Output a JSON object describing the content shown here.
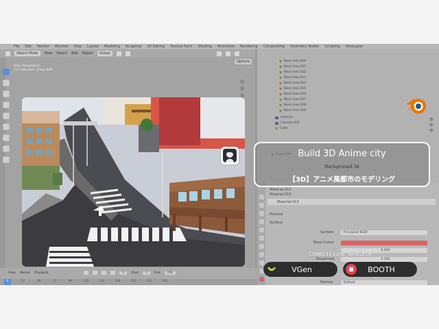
{
  "menubar": {
    "items": [
      "File",
      "Edit",
      "Render",
      "Window",
      "Help",
      "Layout",
      "Modeling",
      "Sculpting",
      "UV Editing",
      "Texture Paint",
      "Shading",
      "Animation",
      "Rendering",
      "Compositing",
      "Geometry Nodes",
      "Scripting",
      "ViewLayer"
    ]
  },
  "viewport": {
    "mode": "Object Mode",
    "menu": [
      "View",
      "Select",
      "Add",
      "Object"
    ],
    "orientation": "Global",
    "options_label": "Options",
    "info_line1": "User Perspective",
    "info_line2": "(1) Collection | Cube.039"
  },
  "outliner": {
    "items": [
      "Neon tree.010",
      "Neon tree.011",
      "Neon tree.012",
      "Neon tree.013",
      "Neon tree.014",
      "Neon tree.015",
      "Neon tree.016",
      "Neon tree.017",
      "Neon tree.018",
      "Neon tree.019",
      "Camera",
      "Camera.001",
      "Cube",
      "Cube.039"
    ]
  },
  "properties": {
    "material_slots": [
      "Material.012",
      "Material.013"
    ],
    "material_name": "Material.013",
    "preview_label": "Preview",
    "surface_label": "Surface",
    "surface_field_label": "Surface",
    "surface_value": "Principled BSDF",
    "base_color_label": "Base Colour",
    "roughness_label": "Roughness",
    "roughness_value": "0.500",
    "metallic_value": "0.000",
    "normal_label": "Normal",
    "normal_value": "Default"
  },
  "timeline": {
    "menu": [
      "View",
      "Marker",
      "Playback"
    ],
    "current_frame": "1",
    "start_label": "Start",
    "start_value": "1",
    "end_label": "End",
    "end_value": "250",
    "ruler": [
      "0",
      "24",
      "48",
      "72",
      "96",
      "120",
      "144",
      "168",
      "192",
      "216",
      "240"
    ]
  },
  "overlay": {
    "title": "Build 3D Anime city",
    "subtitle": "Background 3d",
    "japanese": "【3D】アニメ風都市のモデリング",
    "commissions": "Commissions Avaible",
    "vgen_label": "VGen",
    "booth_label": "BOOTH"
  },
  "colors": {
    "accent": "#5c8fd6",
    "base_color": "#d96262",
    "booth": "#e8434a",
    "vgen": "#b5e83d"
  }
}
